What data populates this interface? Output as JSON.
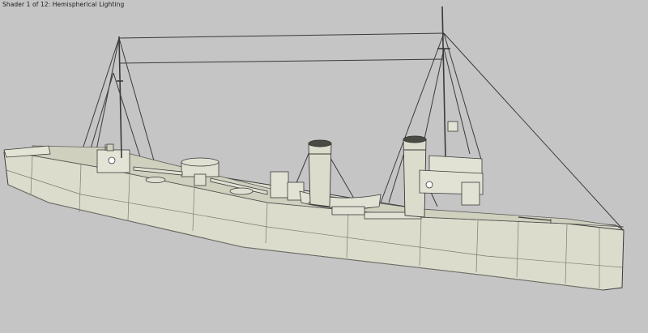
{
  "viewport": {
    "overlay_label": "Shader 1 of 12: Hemispherical Lighting",
    "background_color": "#c5c5c5"
  },
  "model": {
    "subject": "warship",
    "hull_color": "#dcdccd",
    "deck_color": "#cfd0bd",
    "wire_color": "#3a3a3a"
  }
}
